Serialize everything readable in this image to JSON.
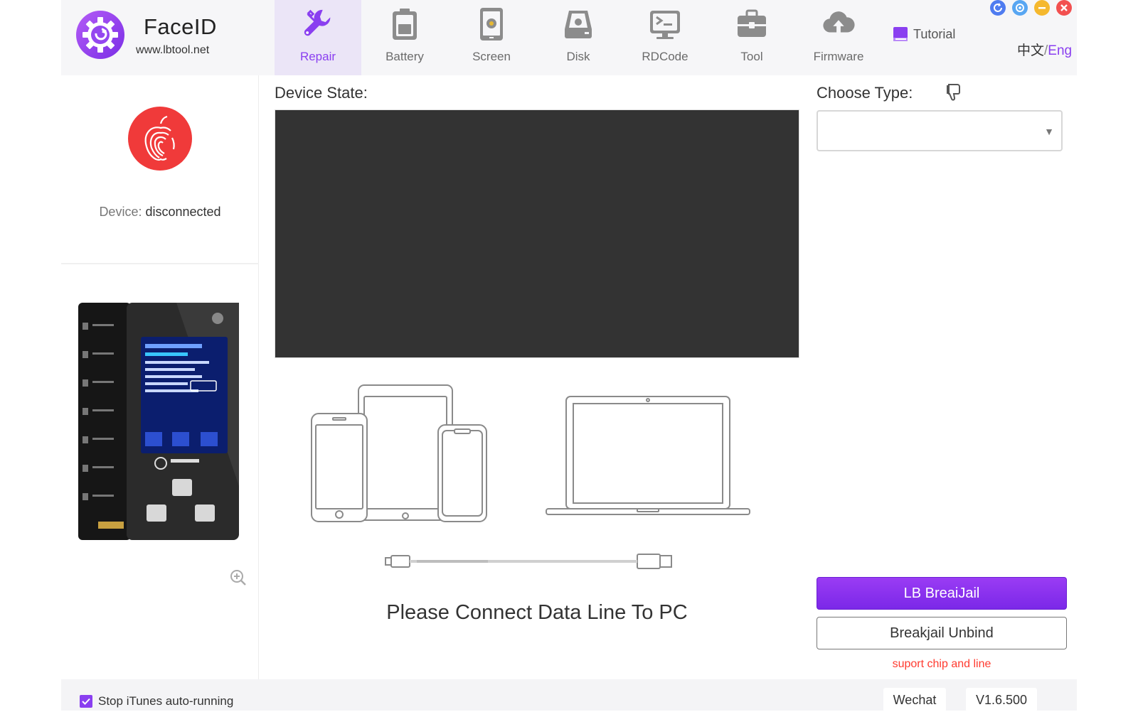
{
  "app": {
    "title": "FaceID",
    "url": "www.lbtool.net"
  },
  "nav": [
    {
      "label": "Repair",
      "icon": "wrench-icon",
      "active": true
    },
    {
      "label": "Battery",
      "icon": "battery-icon",
      "active": false
    },
    {
      "label": "Screen",
      "icon": "screen-icon",
      "active": false
    },
    {
      "label": "Disk",
      "icon": "disk-icon",
      "active": false
    },
    {
      "label": "RDCode",
      "icon": "terminal-icon",
      "active": false
    },
    {
      "label": "Tool",
      "icon": "toolbox-icon",
      "active": false
    },
    {
      "label": "Firmware",
      "icon": "cloud-upload-icon",
      "active": false
    }
  ],
  "header": {
    "tutorial_label": "Tutorial",
    "lang_zh": "中文",
    "lang_sep": "/",
    "lang_en": "Eng"
  },
  "device": {
    "label": "Device: ",
    "status": "disconnected"
  },
  "main": {
    "device_state_label": "Device State:",
    "connect_message": "Please Connect Data Line To PC"
  },
  "right": {
    "choose_type_label": "Choose Type:",
    "select_value": "",
    "primary_button": "LB BreaiJail",
    "secondary_button": "Breakjail Unbind",
    "support_note": "suport chip and line"
  },
  "footer": {
    "stop_itunes_label": "Stop iTunes auto-running",
    "stop_itunes_checked": true,
    "wechat_label": "Wechat",
    "version": "V1.6.500"
  },
  "colors": {
    "accent": "#8a3ff0",
    "console_bg": "#333333",
    "error_red": "#ff3b30",
    "device_logo_red": "#f03a3a"
  }
}
